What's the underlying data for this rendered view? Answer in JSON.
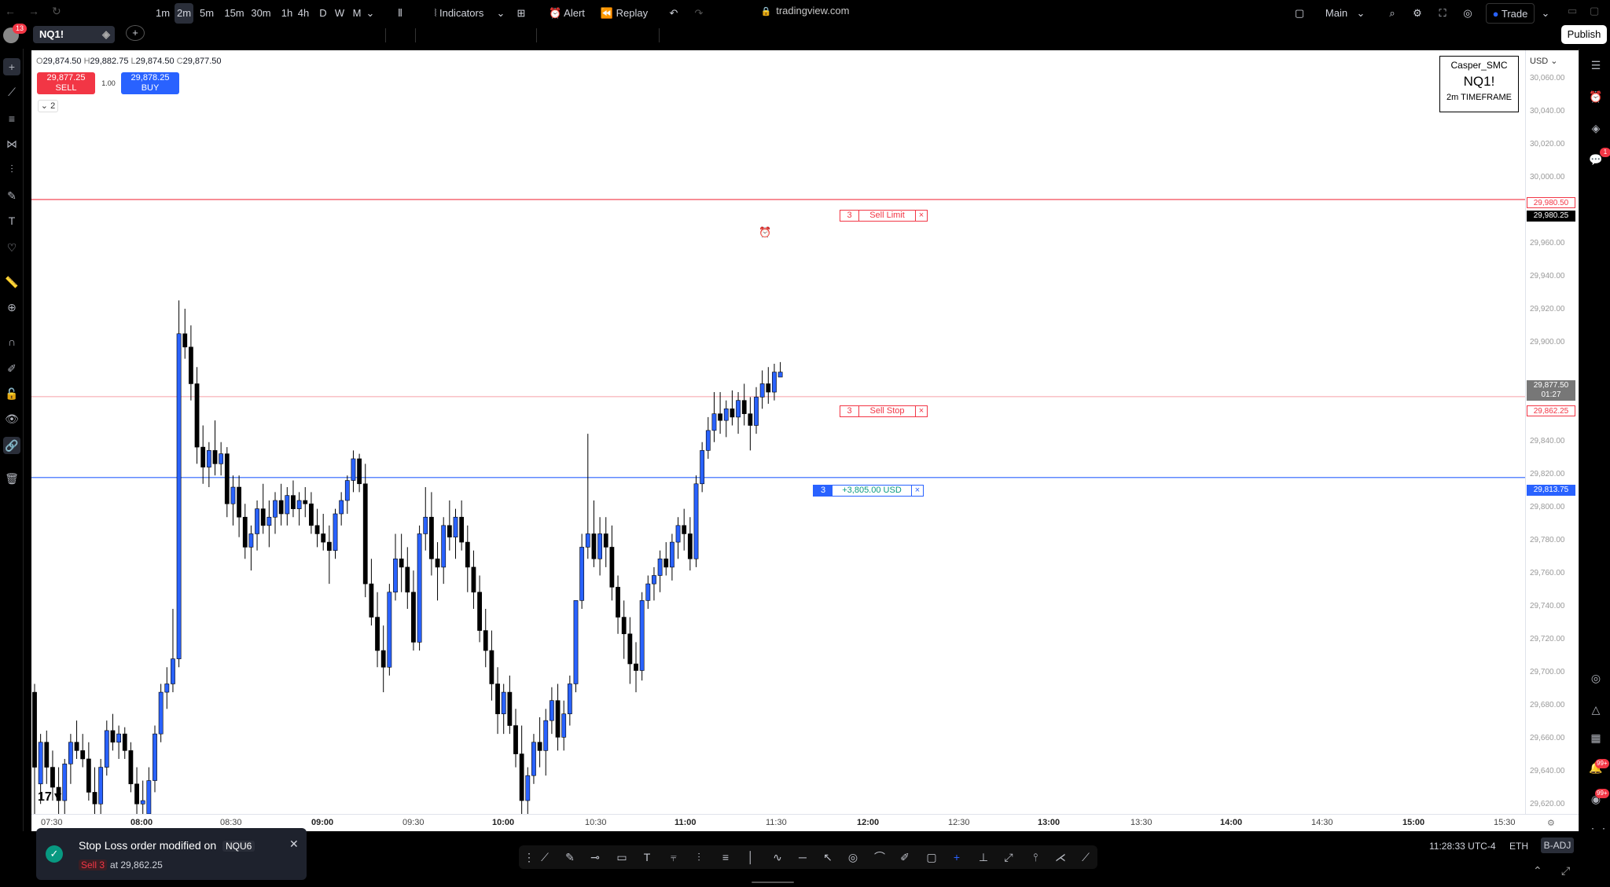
{
  "browser": {
    "url": "tradingview.com"
  },
  "toolbar": {
    "avatar_badge": "13",
    "symbol": "NQ1!",
    "intervals": [
      "1m",
      "2m",
      "5m",
      "15m",
      "30m",
      "1h",
      "4h",
      "D",
      "W",
      "M"
    ],
    "active_interval": "2m",
    "indicators_label": "Indicators",
    "alert_label": "Alert",
    "replay_label": "Replay",
    "layout_label": "Main",
    "trade_label": "Trade",
    "publish_label": "Publish"
  },
  "legend": {
    "open_key": "O",
    "open": "29,874.50",
    "high_key": "H",
    "high": "29,882.75",
    "low_key": "L",
    "low": "29,874.50",
    "close_key": "C",
    "close": "29,877.50",
    "sell_price": "29,877.25",
    "sell_label": "SELL",
    "buy_price": "29,878.25",
    "buy_label": "BUY",
    "quantity": "1.00",
    "collapse_count": "2"
  },
  "watermark": {
    "author": "Casper_SMC",
    "symbol": "NQ1!",
    "timeframe": "2m TIMEFRAME"
  },
  "price_axis": {
    "currency": "USD",
    "ticks": [
      "30,060.00",
      "30,040.00",
      "30,020.00",
      "30,000.00",
      "29,960.00",
      "29,940.00",
      "29,920.00",
      "29,900.00",
      "29,840.00",
      "29,820.00",
      "29,800.00",
      "29,780.00",
      "29,760.00",
      "29,740.00",
      "29,720.00",
      "29,700.00",
      "29,680.00",
      "29,660.00",
      "29,640.00",
      "29,620.00"
    ],
    "labels": {
      "sell_limit_order": "29,980.50",
      "crosshair": "29,980.25",
      "last_price": "29,877.50",
      "countdown": "01:27",
      "sell_stop_order": "29,862.25",
      "position": "29,813.75"
    }
  },
  "time_axis": {
    "ticks": [
      {
        "label": "07:30",
        "bold": false
      },
      {
        "label": "08:00",
        "bold": true
      },
      {
        "label": "08:30",
        "bold": false
      },
      {
        "label": "09:00",
        "bold": true
      },
      {
        "label": "09:30",
        "bold": false
      },
      {
        "label": "10:00",
        "bold": true
      },
      {
        "label": "10:30",
        "bold": false
      },
      {
        "label": "11:00",
        "bold": true
      },
      {
        "label": "11:30",
        "bold": false
      },
      {
        "label": "12:00",
        "bold": true
      },
      {
        "label": "12:30",
        "bold": false
      },
      {
        "label": "13:00",
        "bold": true
      },
      {
        "label": "13:30",
        "bold": false
      },
      {
        "label": "14:00",
        "bold": true
      },
      {
        "label": "14:30",
        "bold": false
      },
      {
        "label": "15:00",
        "bold": true
      },
      {
        "label": "15:30",
        "bold": false
      }
    ]
  },
  "orders": {
    "sell_limit": {
      "qty": "3",
      "label": "Sell Limit",
      "close": "×"
    },
    "sell_stop": {
      "qty": "3",
      "label": "Sell Stop",
      "close": "×"
    },
    "position": {
      "qty": "3",
      "pnl": "+3,805.00 USD",
      "close": "×"
    }
  },
  "colors": {
    "up": "#2962ff",
    "down": "#000000",
    "sell": "#f23645",
    "buy": "#2962ff",
    "profit": "#089981"
  },
  "chart_data": {
    "type": "candlestick",
    "ylim": [
      29612,
      30070
    ],
    "orders": {
      "sell_limit": 29980.5,
      "sell_stop": 29862.25,
      "position": 29813.75
    },
    "candles": [
      [
        29685,
        29690,
        29612,
        29640
      ],
      [
        29630,
        29660,
        29618,
        29655
      ],
      [
        29655,
        29662,
        29630,
        29640
      ],
      [
        29640,
        29650,
        29620,
        29628
      ],
      [
        29628,
        29640,
        29612,
        29620
      ],
      [
        29620,
        29645,
        29612,
        29642
      ],
      [
        29642,
        29660,
        29630,
        29655
      ],
      [
        29655,
        29668,
        29645,
        29650
      ],
      [
        29650,
        29660,
        29640,
        29645
      ],
      [
        29645,
        29655,
        29620,
        29625
      ],
      [
        29625,
        29640,
        29612,
        29618
      ],
      [
        29618,
        29645,
        29612,
        29640
      ],
      [
        29640,
        29668,
        29635,
        29662
      ],
      [
        29662,
        29672,
        29650,
        29655
      ],
      [
        29655,
        29665,
        29645,
        29660
      ],
      [
        29660,
        29664,
        29645,
        29650
      ],
      [
        29650,
        29655,
        29625,
        29630
      ],
      [
        29630,
        29640,
        29612,
        29618
      ],
      [
        29618,
        29632,
        29612,
        29620
      ],
      [
        29612,
        29640,
        29612,
        29632
      ],
      [
        29632,
        29665,
        29625,
        29660
      ],
      [
        29660,
        29690,
        29655,
        29685
      ],
      [
        29685,
        29700,
        29675,
        29690
      ],
      [
        29690,
        29735,
        29685,
        29705
      ],
      [
        29705,
        29920,
        29700,
        29900
      ],
      [
        29900,
        29915,
        29885,
        29892
      ],
      [
        29892,
        29905,
        29860,
        29870
      ],
      [
        29870,
        29880,
        29822,
        29832
      ],
      [
        29832,
        29845,
        29810,
        29820
      ],
      [
        29820,
        29835,
        29808,
        29830
      ],
      [
        29830,
        29848,
        29815,
        29822
      ],
      [
        29822,
        29835,
        29815,
        29828
      ],
      [
        29828,
        29832,
        29790,
        29798
      ],
      [
        29798,
        29815,
        29785,
        29808
      ],
      [
        29808,
        29815,
        29778,
        29790
      ],
      [
        29790,
        29798,
        29765,
        29772
      ],
      [
        29772,
        29785,
        29758,
        29780
      ],
      [
        29780,
        29800,
        29770,
        29795
      ],
      [
        29795,
        29810,
        29780,
        29785
      ],
      [
        29785,
        29800,
        29772,
        29790
      ],
      [
        29790,
        29805,
        29780,
        29800
      ],
      [
        29800,
        29810,
        29785,
        29792
      ],
      [
        29792,
        29808,
        29785,
        29803
      ],
      [
        29803,
        29812,
        29790,
        29795
      ],
      [
        29795,
        29805,
        29785,
        29800
      ],
      [
        29800,
        29808,
        29790,
        29798
      ],
      [
        29798,
        29805,
        29780,
        29785
      ],
      [
        29785,
        29795,
        29772,
        29780
      ],
      [
        29780,
        29792,
        29770,
        29775
      ],
      [
        29775,
        29785,
        29750,
        29770
      ],
      [
        29770,
        29795,
        29765,
        29792
      ],
      [
        29792,
        29805,
        29785,
        29800
      ],
      [
        29800,
        29815,
        29792,
        29812
      ],
      [
        29812,
        29830,
        29805,
        29825
      ],
      [
        29825,
        29828,
        29805,
        29810
      ],
      [
        29810,
        29822,
        29742,
        29750
      ],
      [
        29750,
        29765,
        29725,
        29730
      ],
      [
        29730,
        29745,
        29700,
        29710
      ],
      [
        29710,
        29725,
        29685,
        29700
      ],
      [
        29700,
        29750,
        29695,
        29745
      ],
      [
        29745,
        29780,
        29740,
        29765
      ],
      [
        29765,
        29780,
        29745,
        29760
      ],
      [
        29760,
        29772,
        29735,
        29745
      ],
      [
        29745,
        29758,
        29710,
        29715
      ],
      [
        29715,
        29785,
        29710,
        29780
      ],
      [
        29780,
        29808,
        29770,
        29790
      ],
      [
        29790,
        29805,
        29755,
        29765
      ],
      [
        29765,
        29775,
        29740,
        29760
      ],
      [
        29760,
        29790,
        29750,
        29785
      ],
      [
        29785,
        29800,
        29770,
        29778
      ],
      [
        29778,
        29795,
        29765,
        29790
      ],
      [
        29790,
        29800,
        29770,
        29775
      ],
      [
        29775,
        29785,
        29745,
        29760
      ],
      [
        29760,
        29770,
        29735,
        29745
      ],
      [
        29745,
        29755,
        29715,
        29722
      ],
      [
        29722,
        29735,
        29700,
        29710
      ],
      [
        29710,
        29722,
        29680,
        29690
      ],
      [
        29690,
        29700,
        29660,
        29672
      ],
      [
        29672,
        29690,
        29660,
        29685
      ],
      [
        29685,
        29695,
        29660,
        29665
      ],
      [
        29665,
        29675,
        29640,
        29648
      ],
      [
        29648,
        29665,
        29612,
        29620
      ],
      [
        29620,
        29640,
        29612,
        29635
      ],
      [
        29635,
        29660,
        29630,
        29655
      ],
      [
        29655,
        29670,
        29640,
        29650
      ],
      [
        29650,
        29675,
        29635,
        29668
      ],
      [
        29668,
        29688,
        29660,
        29680
      ],
      [
        29680,
        29690,
        29650,
        29658
      ],
      [
        29658,
        29680,
        29650,
        29672
      ],
      [
        29672,
        29695,
        29665,
        29690
      ],
      [
        29690,
        29730,
        29685,
        29740
      ],
      [
        29740,
        29780,
        29735,
        29772
      ],
      [
        29772,
        29840,
        29765,
        29780
      ],
      [
        29780,
        29800,
        29760,
        29765
      ],
      [
        29765,
        29790,
        29755,
        29780
      ],
      [
        29780,
        29790,
        29760,
        29772
      ],
      [
        29772,
        29785,
        29740,
        29748
      ],
      [
        29748,
        29755,
        29720,
        29730
      ],
      [
        29730,
        29740,
        29705,
        29720
      ],
      [
        29720,
        29730,
        29690,
        29702
      ],
      [
        29702,
        29715,
        29685,
        29698
      ],
      [
        29698,
        29745,
        29692,
        29740
      ],
      [
        29740,
        29755,
        29735,
        29750
      ],
      [
        29750,
        29760,
        29740,
        29755
      ],
      [
        29755,
        29770,
        29745,
        29765
      ],
      [
        29765,
        29775,
        29755,
        29760
      ],
      [
        29760,
        29780,
        29752,
        29775
      ],
      [
        29775,
        29790,
        29765,
        29785
      ],
      [
        29785,
        29795,
        29770,
        29780
      ],
      [
        29780,
        29790,
        29758,
        29765
      ],
      [
        29765,
        29815,
        29760,
        29810
      ],
      [
        29810,
        29835,
        29805,
        29830
      ],
      [
        29830,
        29850,
        29825,
        29842
      ],
      [
        29842,
        29865,
        29835,
        29852
      ],
      [
        29852,
        29865,
        29840,
        29848
      ],
      [
        29848,
        29860,
        29838,
        29855
      ],
      [
        29855,
        29866,
        29845,
        29850
      ],
      [
        29850,
        29865,
        29840,
        29860
      ],
      [
        29860,
        29870,
        29845,
        29852
      ],
      [
        29852,
        29862,
        29830,
        29845
      ],
      [
        29845,
        29868,
        29840,
        29862
      ],
      [
        29862,
        29878,
        29855,
        29870
      ],
      [
        29870,
        29880,
        29858,
        29865
      ],
      [
        29865,
        29882,
        29860,
        29877
      ],
      [
        29874,
        29883,
        29874,
        29877
      ]
    ]
  }
}
